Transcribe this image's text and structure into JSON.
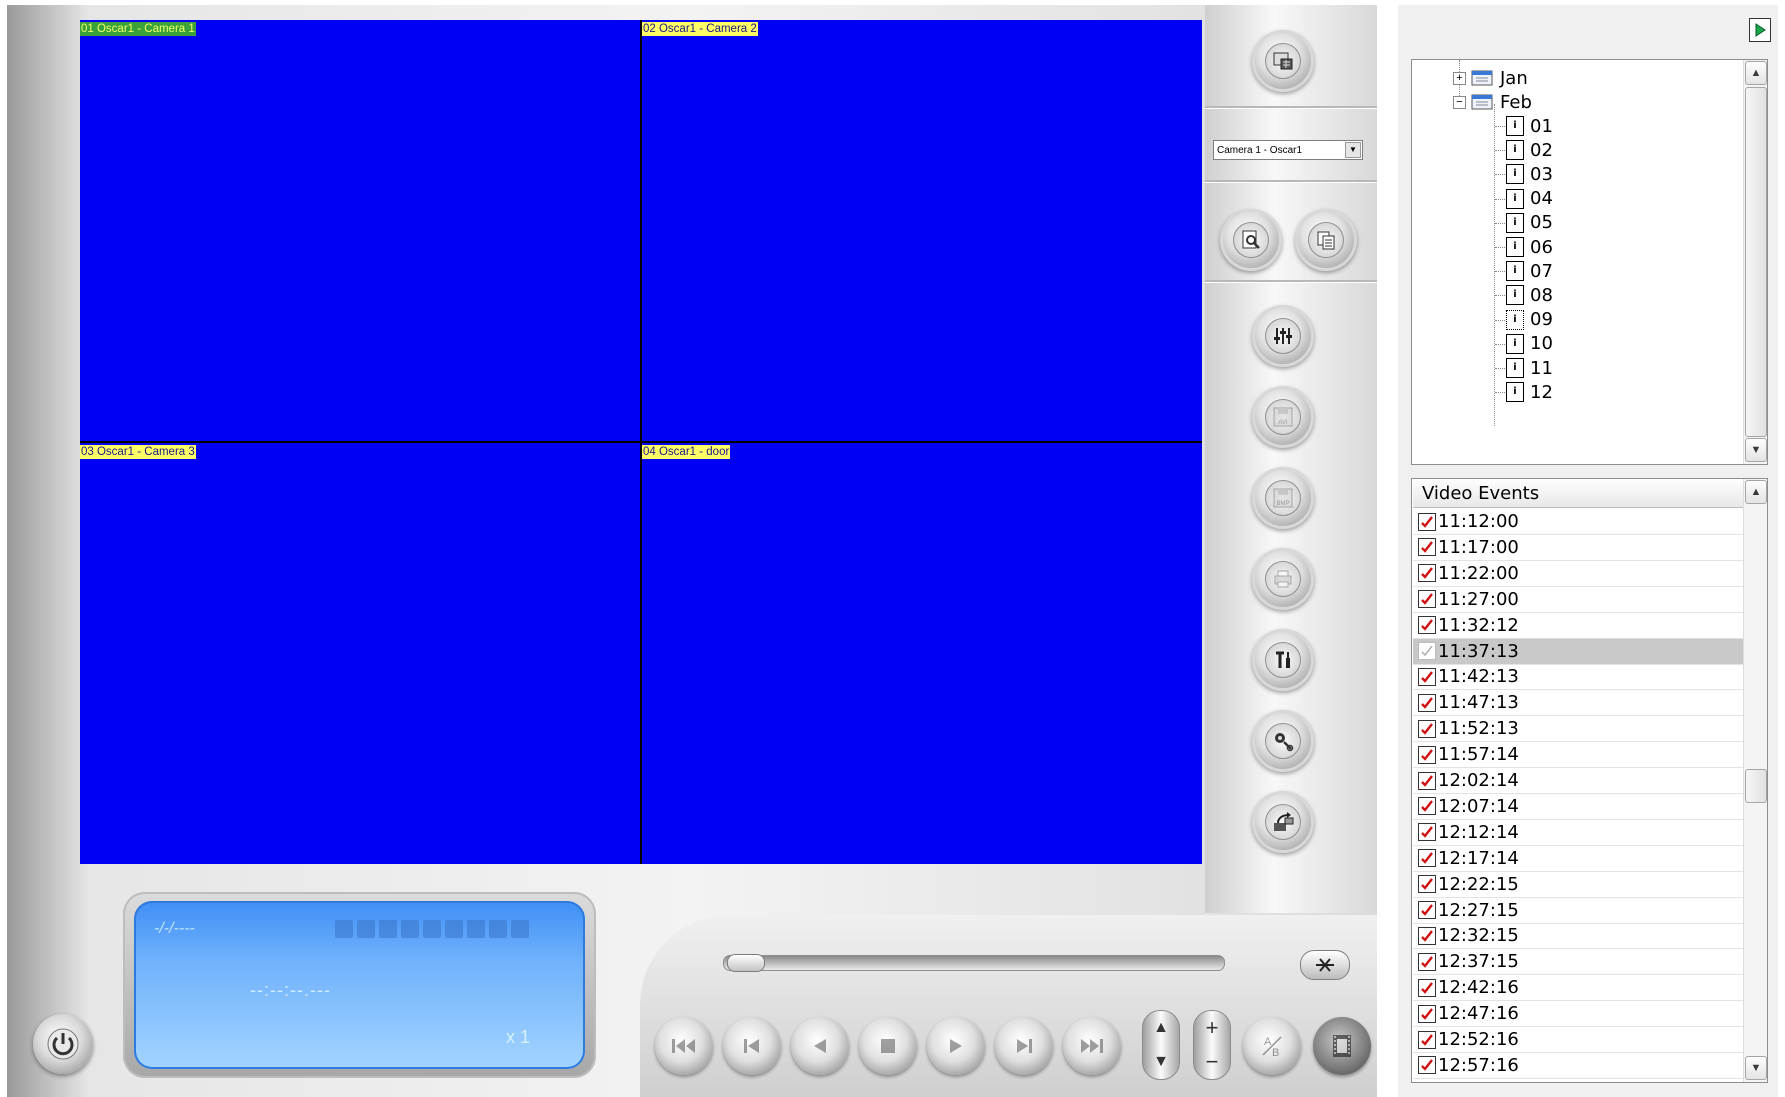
{
  "cameras": [
    {
      "label": "01 Oscar1 - Camera 1"
    },
    {
      "label": "02 Oscar1 - Camera 2"
    },
    {
      "label": "03 Oscar1 - Camera 3"
    },
    {
      "label": "04 Oscar1 - door"
    }
  ],
  "camera_select": {
    "value": "Camera 1 - Oscar1"
  },
  "lcd": {
    "date": "-/-/----",
    "time": "--:--:--.---",
    "speed": "x 1"
  },
  "tree": {
    "months": [
      {
        "label": "Jan",
        "expanded": false
      },
      {
        "label": "Feb",
        "expanded": true
      }
    ],
    "days": [
      "01",
      "02",
      "03",
      "04",
      "05",
      "06",
      "07",
      "08",
      "09",
      "10",
      "11",
      "12"
    ],
    "selected_day": "09"
  },
  "events": {
    "header": "Video Events",
    "items": [
      {
        "time": "11:12:00",
        "checked": true
      },
      {
        "time": "11:17:00",
        "checked": true
      },
      {
        "time": "11:22:00",
        "checked": true
      },
      {
        "time": "11:27:00",
        "checked": true
      },
      {
        "time": "11:32:12",
        "checked": true
      },
      {
        "time": "11:37:13",
        "checked": false,
        "selected": true
      },
      {
        "time": "11:42:13",
        "checked": true
      },
      {
        "time": "11:47:13",
        "checked": true
      },
      {
        "time": "11:52:13",
        "checked": true
      },
      {
        "time": "11:57:14",
        "checked": true
      },
      {
        "time": "12:02:14",
        "checked": true
      },
      {
        "time": "12:07:14",
        "checked": true
      },
      {
        "time": "12:12:14",
        "checked": true
      },
      {
        "time": "12:17:14",
        "checked": true
      },
      {
        "time": "12:22:15",
        "checked": true
      },
      {
        "time": "12:27:15",
        "checked": true
      },
      {
        "time": "12:32:15",
        "checked": true
      },
      {
        "time": "12:37:15",
        "checked": true
      },
      {
        "time": "12:42:16",
        "checked": true
      },
      {
        "time": "12:47:16",
        "checked": true
      },
      {
        "time": "12:52:16",
        "checked": true
      },
      {
        "time": "12:57:16",
        "checked": true
      }
    ]
  },
  "colors": {
    "video_bg": "#0000f4",
    "label_bg": "#ffff66",
    "selected_label_bg": "#3aa23a",
    "lcd": "#6fb1fb",
    "check": "#d01010"
  },
  "icons": {
    "side": [
      "layout-icon",
      "zoom-search-icon",
      "copy-icon",
      "mixer-sliders-icon",
      "save-avi-icon",
      "save-bmp-icon",
      "print-icon",
      "tools-icon",
      "settings-gear-icon",
      "export-icon"
    ],
    "playback": [
      "skip-first-icon",
      "skip-prev-icon",
      "rewind-icon",
      "stop-icon",
      "play-icon",
      "skip-next-icon",
      "skip-last-icon"
    ]
  }
}
